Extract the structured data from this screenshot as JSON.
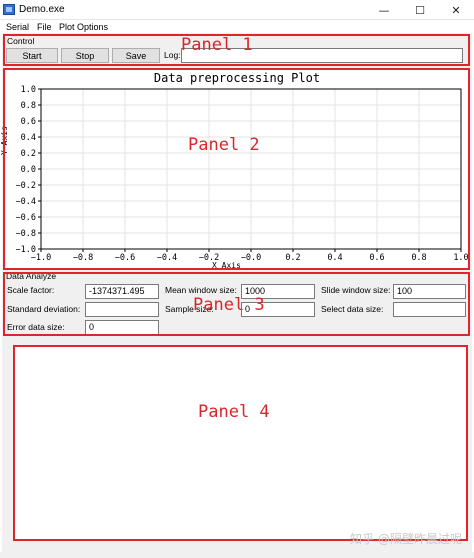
{
  "window": {
    "title": "Demo.exe",
    "controls": {
      "minimize": "—",
      "maximize": "☐",
      "close": "✕"
    }
  },
  "menu": {
    "items": [
      "Serial",
      "File",
      "Plot Options"
    ]
  },
  "control_panel": {
    "group_label": "Control",
    "buttons": {
      "start": "Start",
      "stop": "Stop",
      "save": "Save"
    },
    "log_label": "Log:",
    "log_value": "",
    "annotation": "Panel 1"
  },
  "plot_panel": {
    "annotation": "Panel 2"
  },
  "chart_data": {
    "type": "line",
    "title": "Data preprocessing Plot",
    "xlabel": "X Axis",
    "ylabel": "Y Axis",
    "xlim": [
      -1.0,
      1.0
    ],
    "ylim": [
      -1.0,
      1.0
    ],
    "xticks": [
      "−1.0",
      "−0.8",
      "−0.6",
      "−0.4",
      "−0.2",
      "−0.0",
      "0.2",
      "0.4",
      "0.6",
      "0.8",
      "1.0"
    ],
    "yticks": [
      "1.0",
      "0.8",
      "0.6",
      "0.4",
      "0.2",
      "0.0",
      "−0.2",
      "−0.4",
      "−0.6",
      "−0.8",
      "−1.0"
    ],
    "grid": true,
    "series": []
  },
  "analyze_panel": {
    "group_label": "Data Analyze",
    "annotation": "Panel 3",
    "fields": {
      "scale_factor": {
        "label": "Scale factor:",
        "value": "-1374371.495"
      },
      "mean_window": {
        "label": "Mean window size:",
        "value": "1000"
      },
      "slide_window": {
        "label": "Slide window size:",
        "value": "100"
      },
      "std_dev": {
        "label": "Standard deviation:",
        "value": ""
      },
      "sample_size": {
        "label": "Sample size:",
        "value": "0"
      },
      "select_data": {
        "label": "Select data size:",
        "value": ""
      },
      "error_data": {
        "label": "Error data size:",
        "value": "0"
      }
    }
  },
  "panel4": {
    "annotation": "Panel 4"
  },
  "watermark": "知乎 @隔壁昨晨过呢",
  "colors": {
    "annotation_red": "#e0242b",
    "window_bg": "#f0f0f0",
    "button_face": "#e1e1e1"
  }
}
